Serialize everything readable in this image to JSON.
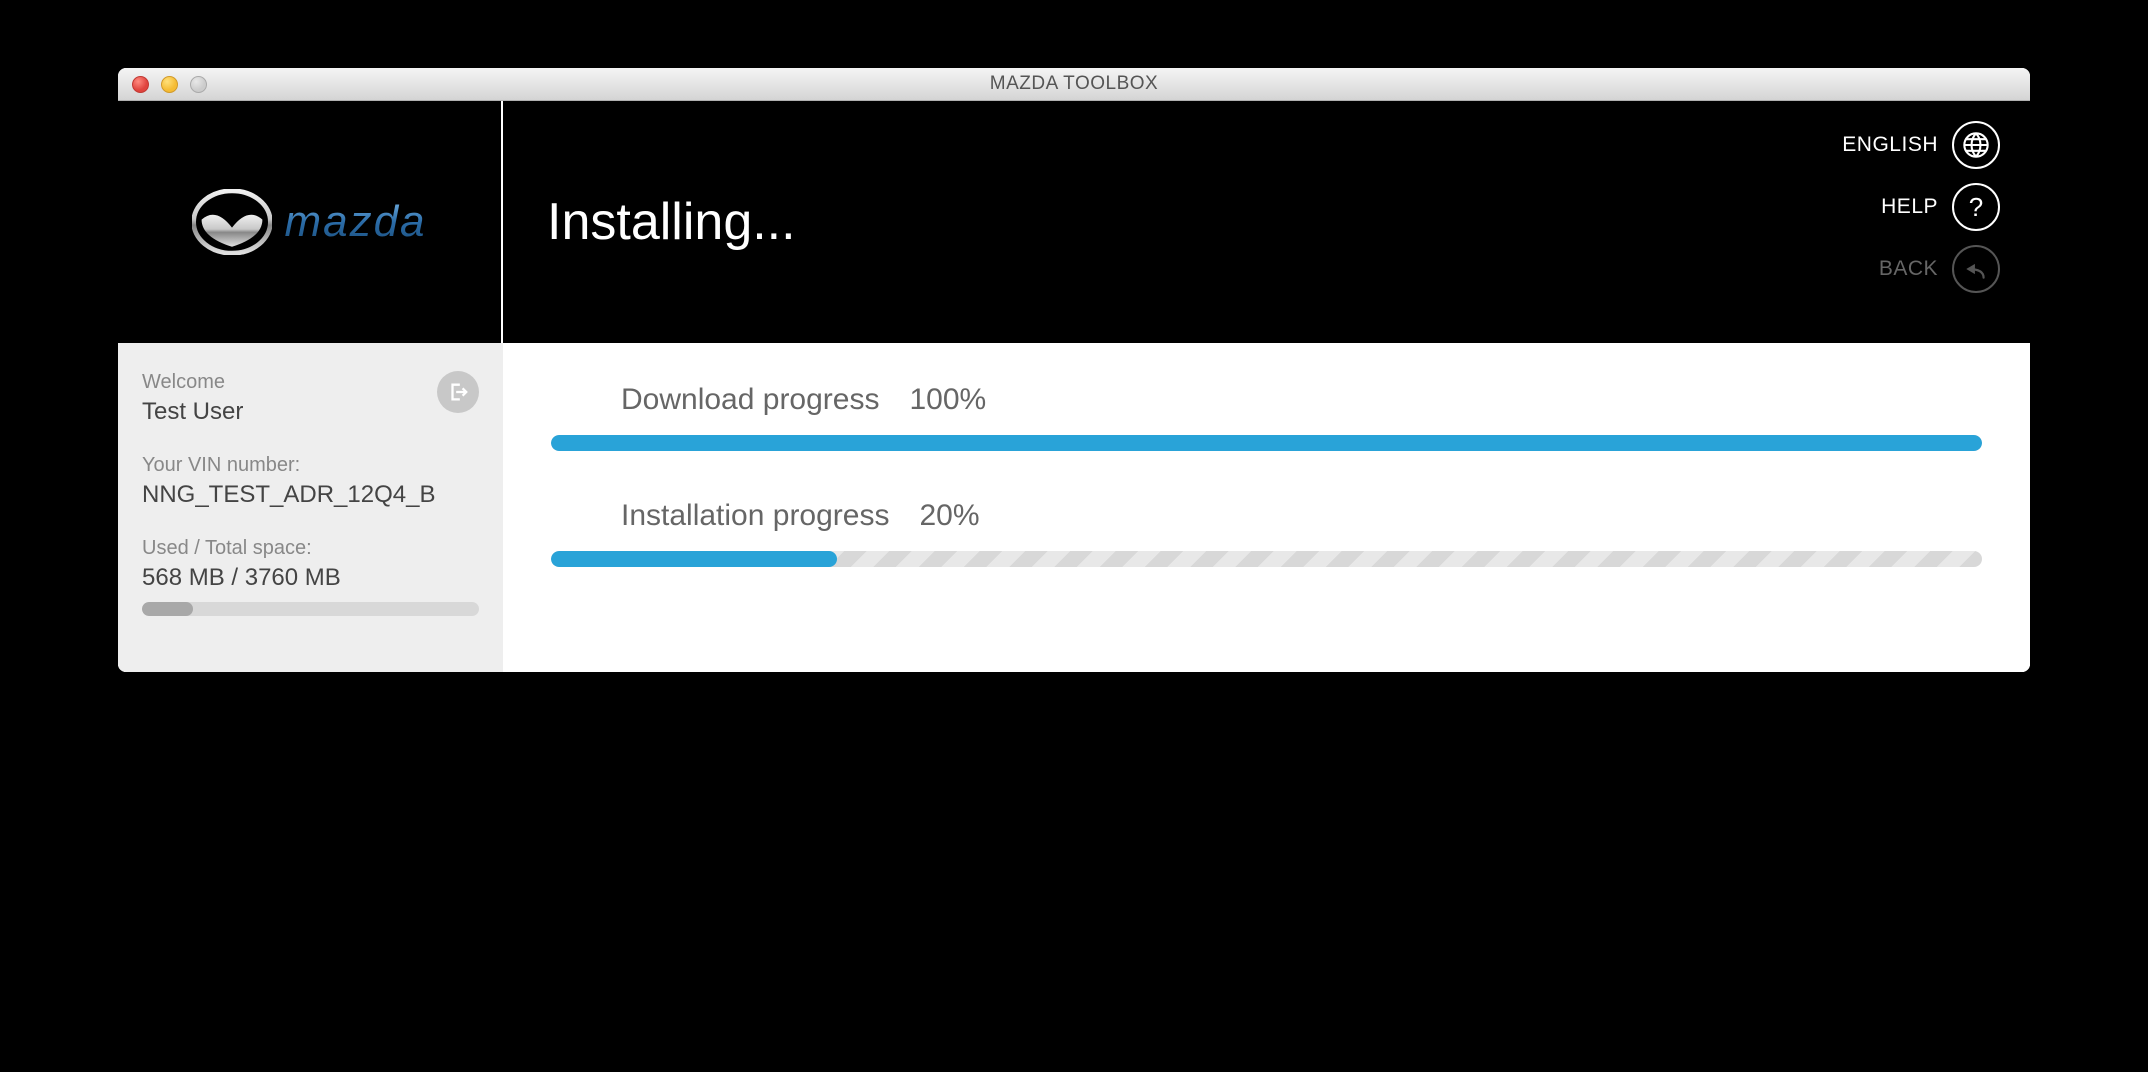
{
  "window": {
    "title": "MAZDA TOOLBOX"
  },
  "header": {
    "page_title": "Installing...",
    "actions": {
      "language": "ENGLISH",
      "help": "HELP",
      "back": "BACK"
    }
  },
  "sidebar": {
    "welcome_label": "Welcome",
    "user_name": "Test User",
    "vin_label": "Your VIN number:",
    "vin_value": "NNG_TEST_ADR_12Q4_B",
    "space_label": "Used / Total space:",
    "space_value": "568 MB / 3760 MB",
    "storage_percent": 15
  },
  "progress": {
    "download": {
      "label": "Download progress",
      "percent_text": "100%",
      "percent": 100
    },
    "install": {
      "label": "Installation progress",
      "percent_text": "20%",
      "percent": 20
    }
  }
}
